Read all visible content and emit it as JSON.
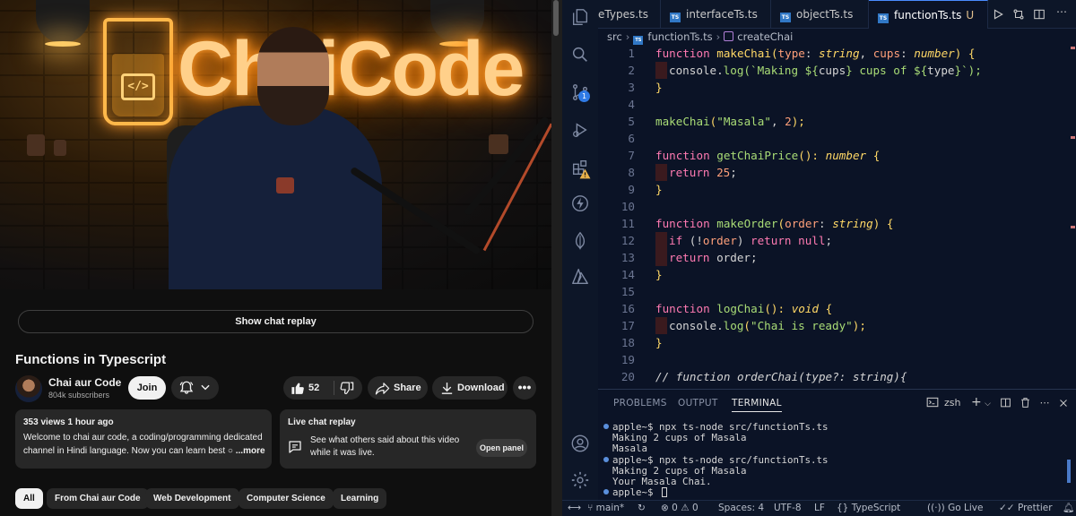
{
  "youtube": {
    "video": {
      "brand_text": "ChaiCode",
      "chat_replay_button": "Show chat replay"
    },
    "title": "Functions in Typescript",
    "channel": {
      "name": "Chai aur Code",
      "subscribers": "804k subscribers",
      "join_label": "Join"
    },
    "actions": {
      "like_count": "52",
      "share_label": "Share",
      "download_label": "Download",
      "more_label": "•••"
    },
    "description": {
      "meta": "353 views  1 hour ago",
      "text": "Welcome to chai aur code, a coding/programming dedicated channel in Hindi language. Now you can learn best ○ ",
      "more": "...more"
    },
    "live_chat": {
      "title": "Live chat replay",
      "text": "See what others said about this video while it was live.",
      "open_panel": "Open panel"
    },
    "chips": [
      "All",
      "From Chai aur Code",
      "Web Development",
      "Computer Science",
      "Learning"
    ]
  },
  "vscode": {
    "tabs": [
      {
        "label": "eTypes.ts",
        "icon": "ts-file-icon"
      },
      {
        "label": "interfaceTs.ts",
        "icon": "ts-file-icon"
      },
      {
        "label": "objectTs.ts",
        "icon": "ts-file-icon"
      },
      {
        "label": "functionTs.ts",
        "icon": "ts-file-icon",
        "modified": "U"
      }
    ],
    "breadcrumb": [
      "src",
      "functionTs.ts",
      "createChai"
    ],
    "scm_badge": "1",
    "code_lines": [
      {
        "n": "1"
      },
      {
        "n": "2"
      },
      {
        "n": "3"
      },
      {
        "n": "4"
      },
      {
        "n": "5"
      },
      {
        "n": "6"
      },
      {
        "n": "7"
      },
      {
        "n": "8"
      },
      {
        "n": "9"
      },
      {
        "n": "10"
      },
      {
        "n": "11"
      },
      {
        "n": "12"
      },
      {
        "n": "13"
      },
      {
        "n": "14"
      },
      {
        "n": "15"
      },
      {
        "n": "16"
      },
      {
        "n": "17"
      },
      {
        "n": "18"
      },
      {
        "n": "19"
      },
      {
        "n": "20"
      }
    ],
    "code": {
      "l1": [
        "function",
        "makeChai",
        "(",
        "type",
        ": ",
        "string",
        ", ",
        "cups",
        ": ",
        "number",
        ") {"
      ],
      "l2": [
        "console",
        ".",
        "log",
        "(`Making ${",
        "cups",
        "} cups of ${",
        "type",
        "}`);"
      ],
      "l3": [
        "}"
      ],
      "l5": [
        "makeChai",
        "(",
        "\"Masala\"",
        ", ",
        "2",
        ");"
      ],
      "l7": [
        "function",
        "getChaiPrice",
        "(): ",
        "number",
        " {"
      ],
      "l8": [
        "return",
        "25",
        ";"
      ],
      "l9": [
        "}"
      ],
      "l11": [
        "function",
        "makeOrder",
        "(",
        "order",
        ": ",
        "string",
        ") {"
      ],
      "l12": [
        "if",
        " (!",
        "order",
        ") ",
        "return",
        "null",
        ";"
      ],
      "l13": [
        "return",
        "order",
        ";"
      ],
      "l14": [
        "}"
      ],
      "l16": [
        "function",
        "logChai",
        "(): ",
        "void",
        " {"
      ],
      "l17": [
        "console",
        ".",
        "log",
        "(",
        "\"Chai is ready\"",
        ");"
      ],
      "l18": [
        "}"
      ],
      "l20": [
        "// function orderChai(type?: string){"
      ]
    },
    "panel": {
      "tabs": [
        "PROBLEMS",
        "OUTPUT",
        "TERMINAL"
      ],
      "active_tab": "TERMINAL",
      "shell": "zsh",
      "terminal": [
        "apple~$ npx ts-node src/functionTs.ts",
        "Making 2 cups of Masala",
        "Masala",
        "apple~$ npx ts-node src/functionTs.ts",
        "Making 2 cups of Masala",
        "Your Masala Chai.",
        "apple~$ "
      ]
    },
    "status": {
      "branch": "main*",
      "errors": "0",
      "warnings": "0",
      "spaces": "Spaces: 4",
      "encoding": "UTF-8",
      "eol": "LF",
      "language": "TypeScript",
      "golive": "Go Live",
      "prettier": "Prettier"
    }
  }
}
